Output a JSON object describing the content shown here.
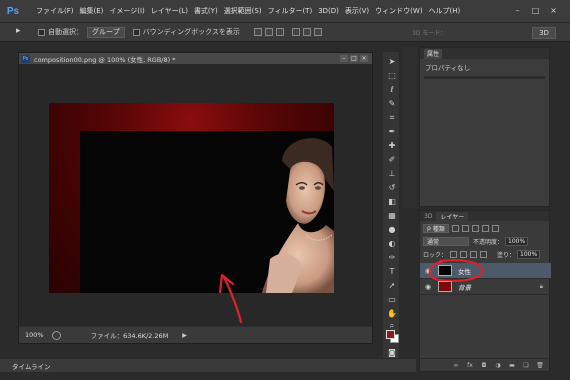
{
  "app": {
    "logo": "Ps"
  },
  "menu": [
    "ファイル(F)",
    "編集(E)",
    "イメージ(I)",
    "レイヤー(L)",
    "書式(Y)",
    "選択範囲(S)",
    "フィルター(T)",
    "3D(D)",
    "表示(V)",
    "ウィンドウ(W)",
    "ヘルプ(H)"
  ],
  "window_controls": {
    "minimize": "–",
    "maximize": "□",
    "close": "×"
  },
  "options": {
    "auto_select_label": "自動選択：",
    "auto_select_value": "グループ",
    "bounding_box_label": "バウンディングボックスを表示",
    "mode_3d_label": "3D モード：",
    "btn_3d": "3D"
  },
  "document": {
    "title": "composition00.png @ 100% (女性, RGB/8) *",
    "zoom": "100%",
    "file_info": "ファイル：634.6K/2.26M",
    "status_arrow": "▶"
  },
  "properties": {
    "tab": "属性",
    "text": "プロパティなし"
  },
  "layers": {
    "tabs": [
      "3D",
      "レイヤー"
    ],
    "kind_label": "種類",
    "blend_mode": "通常",
    "opacity_label": "不透明度：",
    "opacity_value": "100%",
    "lock_label": "ロック：",
    "fill_label": "塗り：",
    "fill_value": "100%",
    "items": [
      {
        "name": "女性",
        "selected": true
      },
      {
        "name": "背景",
        "selected": false,
        "locked": true
      }
    ]
  },
  "timeline": {
    "label": "タイムライン"
  },
  "colors": {
    "foreground": "#8b1a1a",
    "background": "#ffffff",
    "selected_layer": "#4e5a6a",
    "annotation": "#e0202a"
  }
}
